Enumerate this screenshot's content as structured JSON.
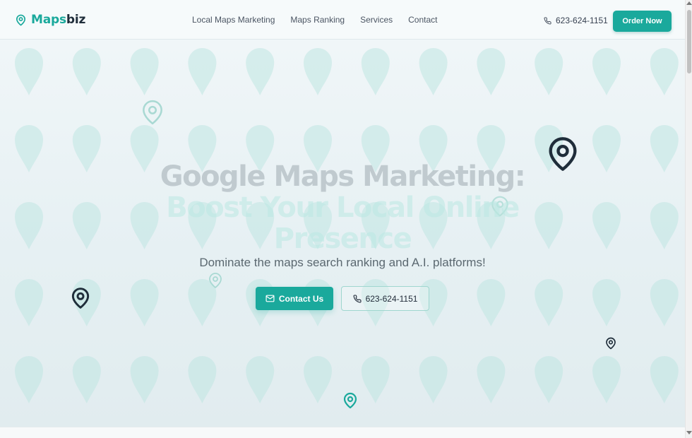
{
  "brand": {
    "name_part1": "Maps",
    "name_part2": "biz",
    "logo_icon": "map-pin-icon",
    "accent_color": "#1aa99c",
    "dark_color": "#1f2d3a"
  },
  "nav": {
    "items": [
      {
        "label": "Local Maps Marketing"
      },
      {
        "label": "Maps Ranking"
      },
      {
        "label": "Services"
      },
      {
        "label": "Contact"
      }
    ]
  },
  "header": {
    "phone": "623-624-1151",
    "phone_icon": "phone-icon",
    "order_label": "Order Now"
  },
  "hero": {
    "title_line1": "Google Maps Marketing:",
    "title_line2a": "Boost Your Local Online",
    "title_line2b": "Presence",
    "subtitle": "Dominate the maps search ranking and A.I. platforms!",
    "contact_label": "Contact Us",
    "contact_icon": "mail-icon",
    "phone_label": "623-624-1151",
    "phone_icon": "phone-icon",
    "background_icon": "map-pin-icon"
  }
}
